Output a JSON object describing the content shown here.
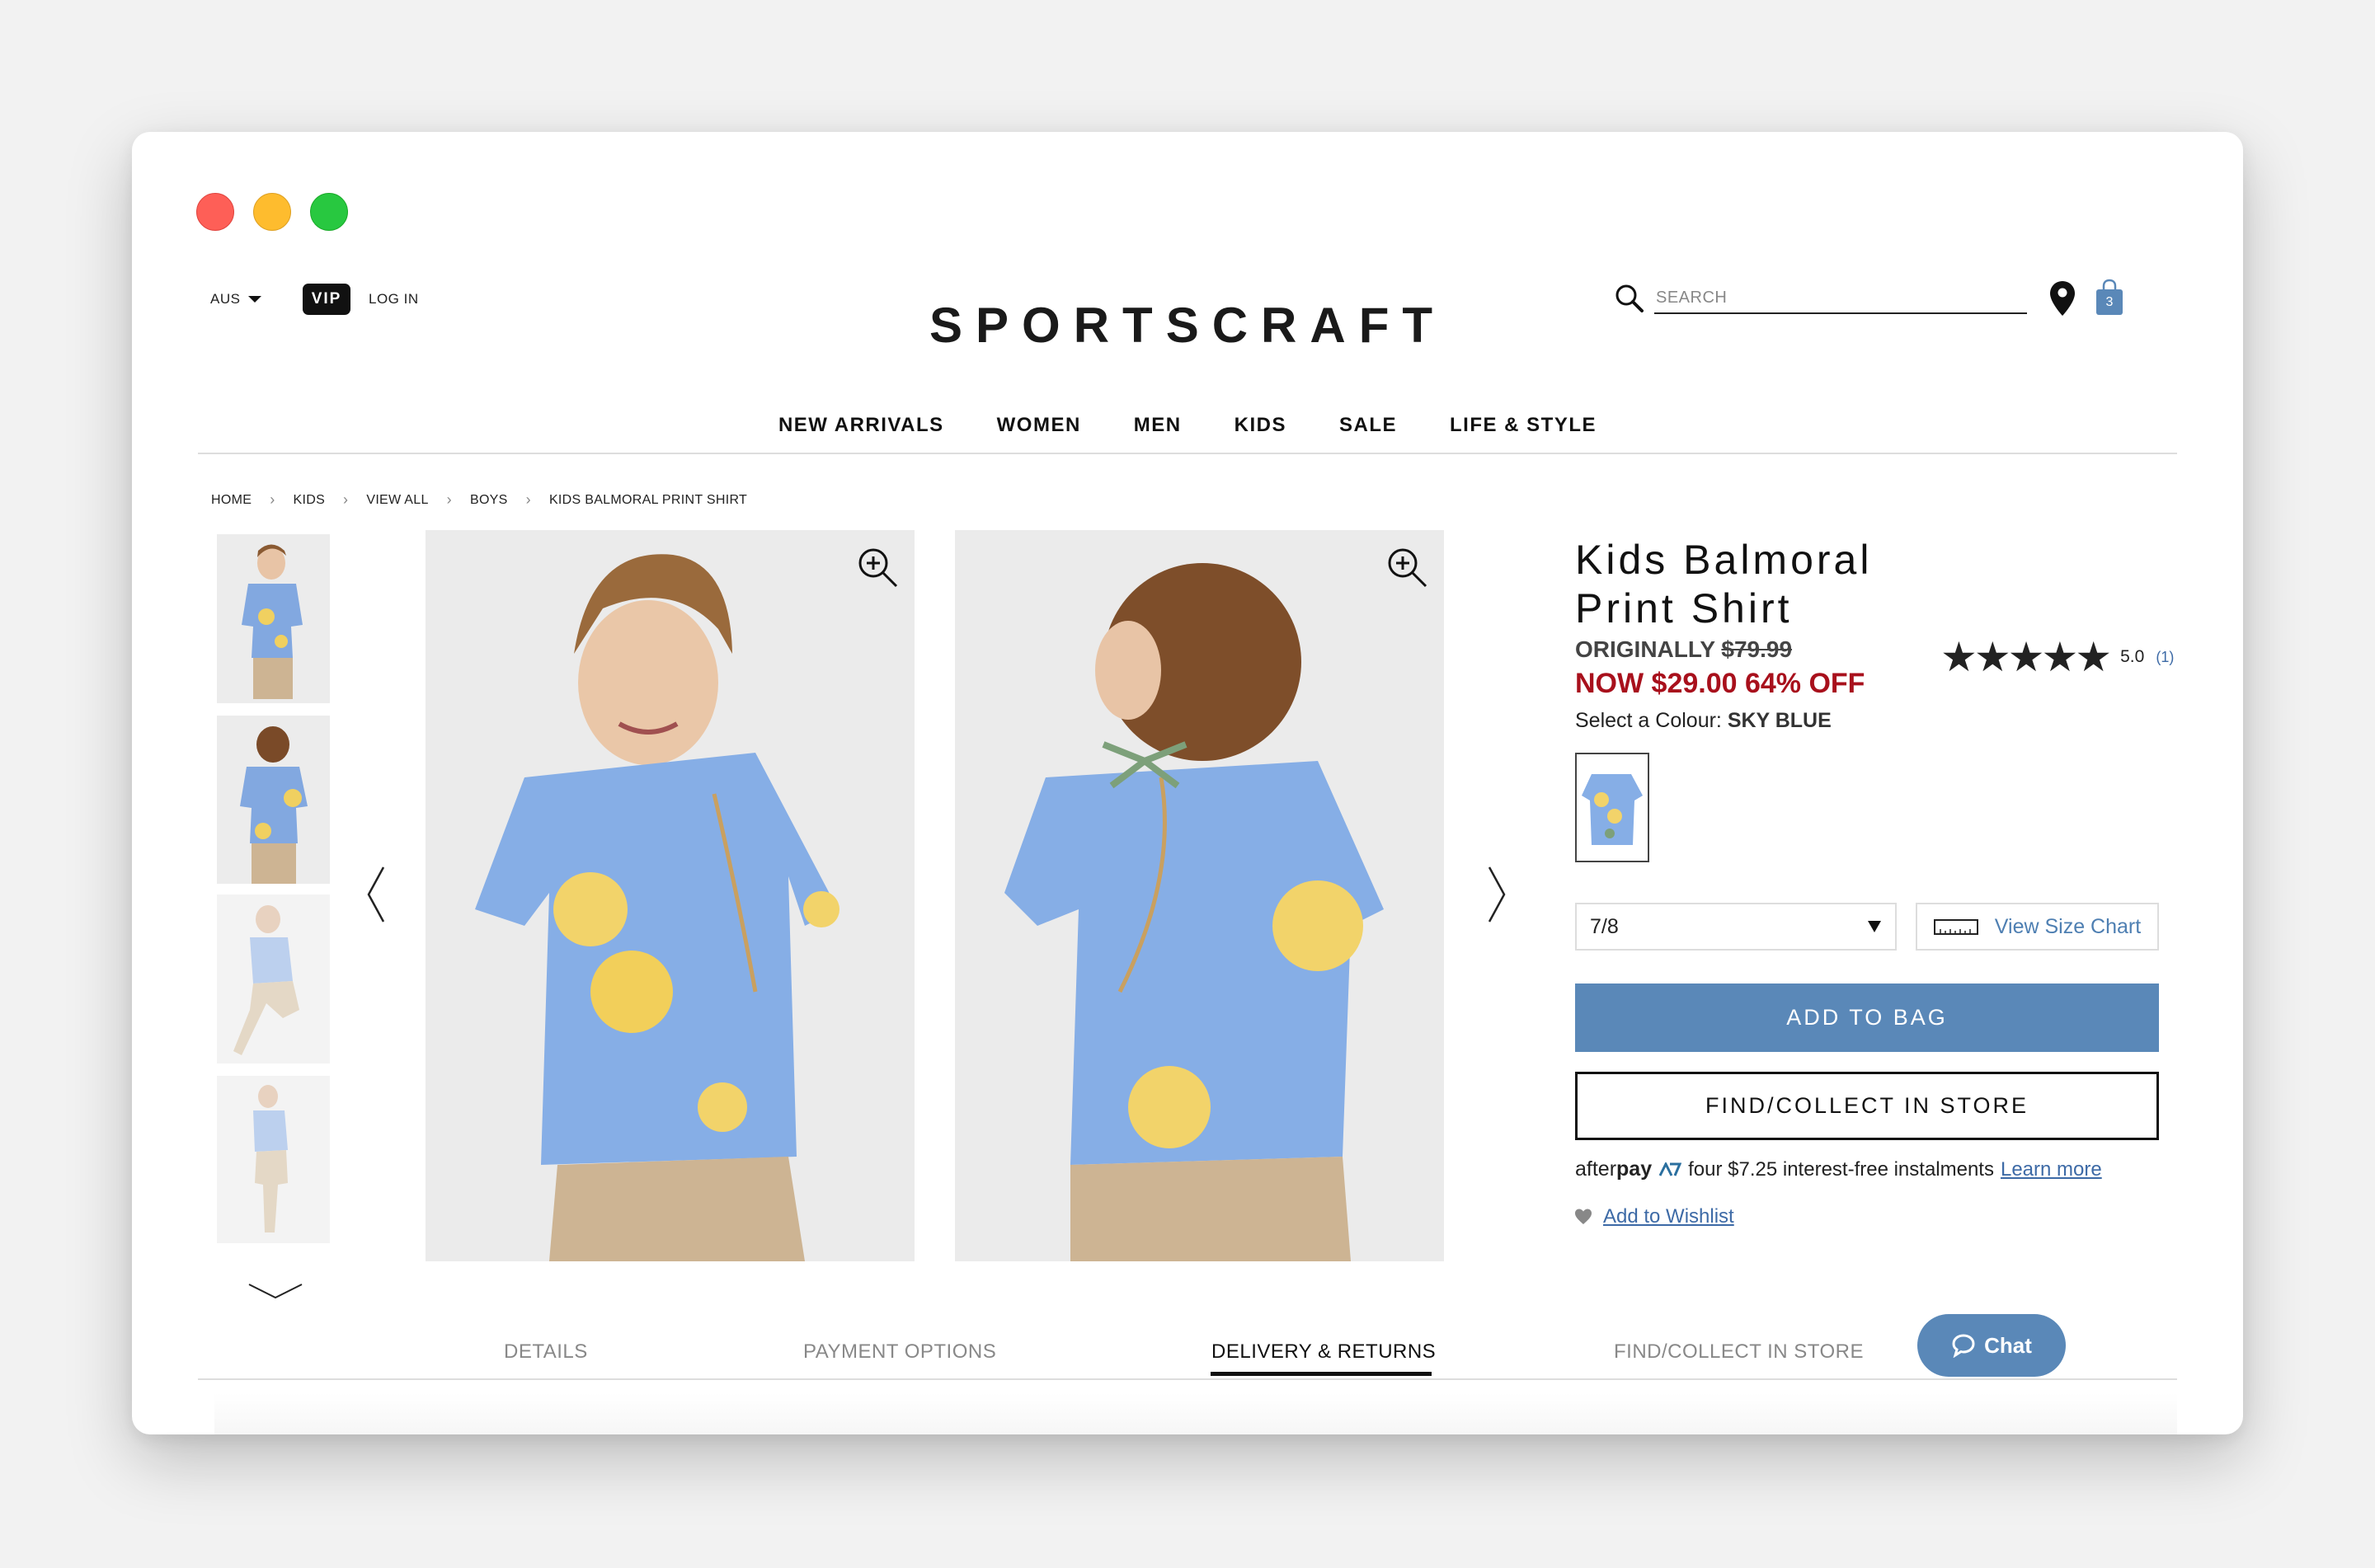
{
  "window": {
    "controls": [
      "close",
      "minimize",
      "maximize"
    ],
    "colors": {
      "close": "#fe5f57",
      "minimize": "#febc2e",
      "maximize": "#28c840"
    }
  },
  "header": {
    "region": "AUS",
    "vip_label": "VIP",
    "login_label": "LOG IN",
    "logo": "SPORTSCRAFT",
    "search": {
      "placeholder": "SEARCH",
      "value": ""
    },
    "bag_count": "3",
    "icons": [
      "search-icon",
      "location-pin-icon",
      "shopping-bag-icon"
    ]
  },
  "nav": {
    "items": [
      "NEW ARRIVALS",
      "WOMEN",
      "MEN",
      "KIDS",
      "SALE",
      "LIFE & STYLE"
    ]
  },
  "breadcrumb": [
    "HOME",
    "KIDS",
    "VIEW ALL",
    "BOYS",
    "KIDS BALMORAL PRINT SHIRT"
  ],
  "gallery": {
    "thumbnails": [
      "front view",
      "back view",
      "side walking view",
      "full length view"
    ],
    "images": [
      "front view",
      "back view"
    ]
  },
  "product": {
    "title_line1": "Kids Balmoral",
    "title_line2": "Print Shirt",
    "originally_label": "ORIGINALLY",
    "original_price": "$79.99",
    "now_price": "NOW $29.00 64% OFF",
    "colour_label": "Select a Colour:",
    "colour_value": "SKY BLUE",
    "rating": {
      "stars": 5,
      "max": 5,
      "value": "5.0",
      "count": "(1)"
    },
    "size": {
      "selected": "7/8"
    },
    "size_chart_label": "View Size Chart",
    "add_to_bag_label": "ADD TO BAG",
    "find_store_label": "FIND/COLLECT IN STORE",
    "afterpay": {
      "logo_light": "after",
      "logo_bold": "pay",
      "text": "four $7.25 interest-free instalments",
      "link": "Learn more"
    },
    "wishlist_label": "Add to Wishlist"
  },
  "tabs": {
    "items": [
      "DETAILS",
      "PAYMENT OPTIONS",
      "DELIVERY & RETURNS",
      "FIND/COLLECT IN STORE"
    ],
    "active": "DELIVERY & RETURNS"
  },
  "chat": {
    "label": "Chat"
  },
  "colors": {
    "accent_blue": "#5a88b8",
    "sale_red": "#a8101c",
    "link_blue": "#3d6aa6"
  }
}
